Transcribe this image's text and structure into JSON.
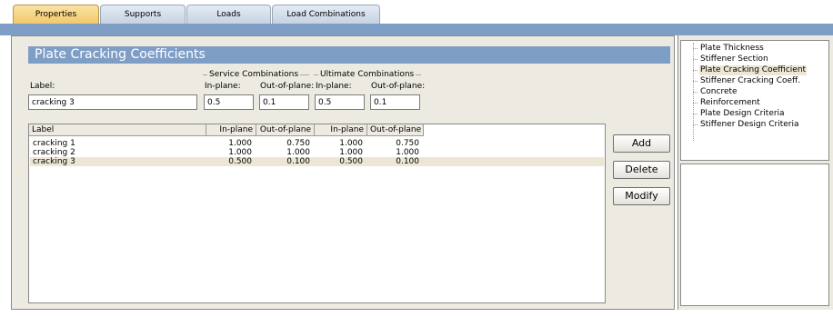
{
  "tabs": [
    {
      "label": "Properties",
      "active": true
    },
    {
      "label": "Supports",
      "active": false
    },
    {
      "label": "Loads",
      "active": false
    },
    {
      "label": "Load Combinations",
      "active": false
    }
  ],
  "panel": {
    "title": "Plate Cracking Coefficients"
  },
  "form": {
    "label_caption": "Label:",
    "label_value": "cracking 3",
    "service_group": "Service Combinations",
    "ultimate_group": "Ultimate Combinations",
    "inplane_caption": "In-plane:",
    "outplane_caption": "Out-of-plane:",
    "service_inplane": "0.5",
    "service_outplane": "0.1",
    "ultimate_inplane": "0.5",
    "ultimate_outplane": "0.1"
  },
  "table": {
    "columns": [
      "Label",
      "In-plane",
      "Out-of-plane",
      "In-plane",
      "Out-of-plane"
    ],
    "rows": [
      {
        "label": "cracking 1",
        "s_in": "1.000",
        "s_out": "0.750",
        "u_in": "1.000",
        "u_out": "0.750",
        "selected": false
      },
      {
        "label": "cracking 2",
        "s_in": "1.000",
        "s_out": "1.000",
        "u_in": "1.000",
        "u_out": "1.000",
        "selected": false
      },
      {
        "label": "cracking 3",
        "s_in": "0.500",
        "s_out": "0.100",
        "u_in": "0.500",
        "u_out": "0.100",
        "selected": true
      }
    ]
  },
  "buttons": {
    "add": "Add",
    "delete": "Delete",
    "modify": "Modify"
  },
  "tree": [
    {
      "label": "Plate Thickness",
      "selected": false
    },
    {
      "label": "Stiffener Section",
      "selected": false
    },
    {
      "label": "Plate Cracking Coefficient",
      "selected": true
    },
    {
      "label": "Stiffener Cracking Coeff.",
      "selected": false
    },
    {
      "label": "Concrete",
      "selected": false
    },
    {
      "label": "Reinforcement",
      "selected": false
    },
    {
      "label": "Plate Design Criteria",
      "selected": false
    },
    {
      "label": "Stiffener Design Criteria",
      "selected": false
    }
  ],
  "colors": {
    "accent": "#7f9ec6",
    "active_tab": "#f2c96a",
    "panel_bg": "#edeae2",
    "selection": "#ede6d4"
  }
}
